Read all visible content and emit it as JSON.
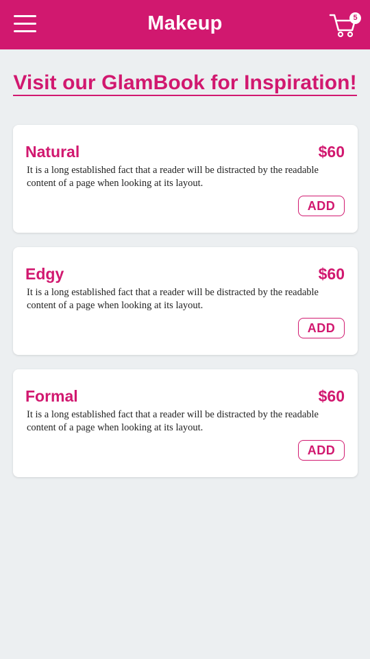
{
  "header": {
    "title": "Makeup",
    "cart_count": "5",
    "menu_icon": "hamburger-menu-icon",
    "cart_icon": "shopping-cart-icon"
  },
  "promo_link": "Visit our GlamBook for Inspiration!",
  "colors": {
    "brand": "#d1186f",
    "background": "#eceff1",
    "card": "#ffffff"
  },
  "products": [
    {
      "name": "Natural",
      "price": "$60",
      "description": "It is a long established fact that a reader will be distracted by the readable content of a page when looking at its layout.",
      "add_label": "ADD"
    },
    {
      "name": "Edgy",
      "price": "$60",
      "description": "It is a long established fact that a reader will be distracted by the readable content of a page when looking at its layout.",
      "add_label": "ADD"
    },
    {
      "name": "Formal",
      "price": "$60",
      "description": "It is a long established fact that a reader will be distracted by the readable content of a page when looking at its layout.",
      "add_label": "ADD"
    }
  ]
}
